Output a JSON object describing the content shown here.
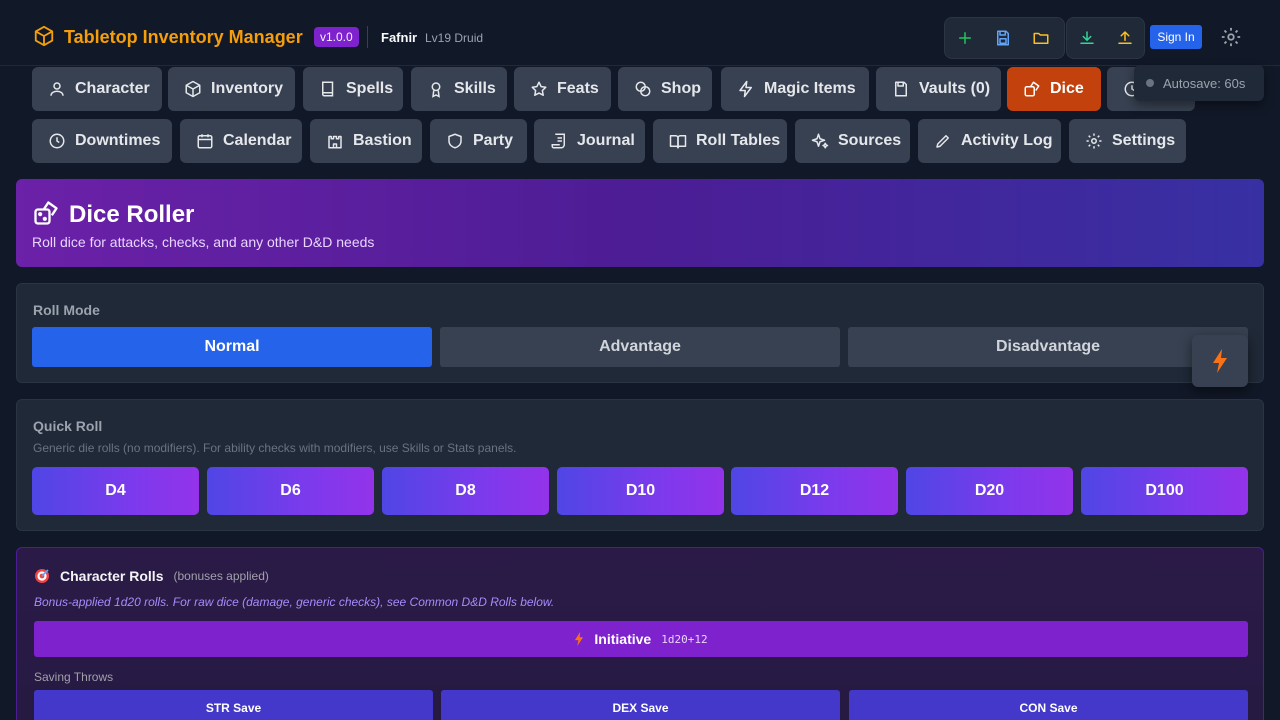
{
  "header": {
    "app_title": "Tabletop Inventory Manager",
    "version": "v1.0.0",
    "character_name": "Fafnir",
    "character_class": "Lv19 Druid",
    "sign_in": "Sign In",
    "icons": [
      "plus-icon",
      "save-icon",
      "folder-icon",
      "download-icon",
      "upload-icon",
      "gear-icon"
    ]
  },
  "nav": {
    "row1": [
      "Character",
      "Inventory",
      "Spells",
      "Skills",
      "Feats",
      "Shop",
      "Magic Items",
      "Vaults (0)",
      "Dice"
    ],
    "row2": [
      "Downtimes",
      "Calendar",
      "Bastion",
      "Party",
      "Journal",
      "Roll Tables",
      "Sources",
      "Activity Log",
      "Settings"
    ],
    "active": "Dice"
  },
  "autosave": {
    "label": "Autosave: 60s"
  },
  "banner": {
    "title": "Dice Roller",
    "subtitle": "Roll dice for attacks, checks, and any other D&D needs"
  },
  "roll_mode": {
    "label": "Roll Mode",
    "options": [
      "Normal",
      "Advantage",
      "Disadvantage"
    ],
    "selected": "Normal"
  },
  "quick_roll": {
    "label": "Quick Roll",
    "note": "Generic die rolls (no modifiers). For ability checks with modifiers, use Skills or Stats panels.",
    "dice": [
      "D4",
      "D6",
      "D8",
      "D10",
      "D12",
      "D20",
      "D100"
    ]
  },
  "character_rolls": {
    "title": "Character Rolls",
    "hint": "(bonuses applied)",
    "note": "Bonus-applied 1d20 rolls. For raw dice (damage, generic checks), see Common D&D Rolls below.",
    "initiative": {
      "label": "Initiative",
      "formula": "1d20+12"
    },
    "saving_throws_label": "Saving Throws",
    "saves": [
      "STR Save",
      "DEX Save",
      "CON Save"
    ]
  },
  "colors": {
    "accent_orange": "#c2410c",
    "primary_blue": "#2563eb",
    "purple": "#7e22ce",
    "brand_amber": "#f59e0b"
  }
}
